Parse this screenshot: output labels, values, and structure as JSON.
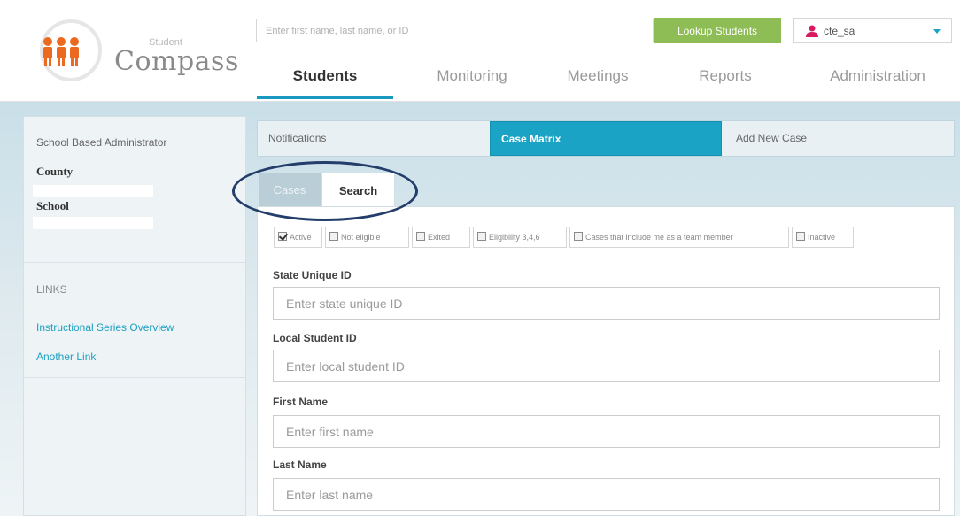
{
  "logo": {
    "small": "Student",
    "big": "Compass"
  },
  "header": {
    "lookup_placeholder": "Enter first name, last name, or ID",
    "lookup_button": "Lookup Students",
    "user_name": "cte_sa"
  },
  "nav": {
    "tabs": [
      "Students",
      "Monitoring",
      "Meetings",
      "Reports",
      "Administration"
    ]
  },
  "sidebar": {
    "role": "School Based Administrator",
    "county_label": "County",
    "school_label": "School",
    "links_heading": "LINKS",
    "links": [
      "Instructional Series Overview",
      "Another Link"
    ]
  },
  "subtabs": [
    "Notifications",
    "Case Matrix",
    "Add New Case"
  ],
  "inner_tabs": {
    "cases": "Cases",
    "search": "Search"
  },
  "filters": [
    {
      "label": "Active",
      "checked": true
    },
    {
      "label": "Not eligible",
      "checked": false
    },
    {
      "label": "Exited",
      "checked": false
    },
    {
      "label": "Eligibility 3,4,6",
      "checked": false
    },
    {
      "label": "Cases that include me as a team member",
      "checked": false
    },
    {
      "label": "Inactive",
      "checked": false
    }
  ],
  "fields": [
    {
      "label": "State Unique ID",
      "placeholder": "Enter state unique ID"
    },
    {
      "label": "Local Student ID",
      "placeholder": "Enter local student ID"
    },
    {
      "label": "First Name",
      "placeholder": "Enter first name"
    },
    {
      "label": "Last Name",
      "placeholder": "Enter last name"
    }
  ],
  "colors": {
    "accent": "#1aa3c4",
    "lookup_green": "#8dbd54",
    "annotation": "#243e6b"
  }
}
